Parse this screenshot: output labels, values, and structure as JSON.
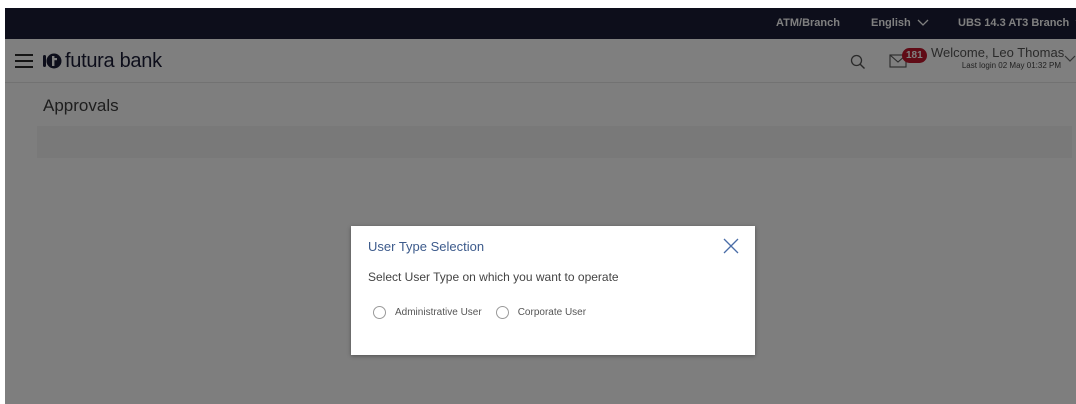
{
  "topbar": {
    "atm_branch": "ATM/Branch",
    "language": "English",
    "branch": "UBS 14.3 AT3 Branch"
  },
  "header": {
    "brand": "futura bank",
    "mail_count": "181",
    "welcome": "Welcome, Leo Thomas",
    "last_login": "Last login 02 May 01:32 PM"
  },
  "main": {
    "title": "Approvals"
  },
  "modal": {
    "title": "User Type Selection",
    "prompt": "Select User Type on which you want to operate",
    "options": [
      {
        "label": "Administrative User",
        "selected": false
      },
      {
        "label": "Corporate User",
        "selected": false
      }
    ]
  },
  "colors": {
    "topbar": "#1b1d36",
    "badge": "#c0162c",
    "modal_title": "#3d5b8c"
  },
  "icons": [
    "menu-icon",
    "futura-logo-icon",
    "search-icon",
    "mail-icon",
    "chevron-down-icon",
    "close-icon"
  ]
}
